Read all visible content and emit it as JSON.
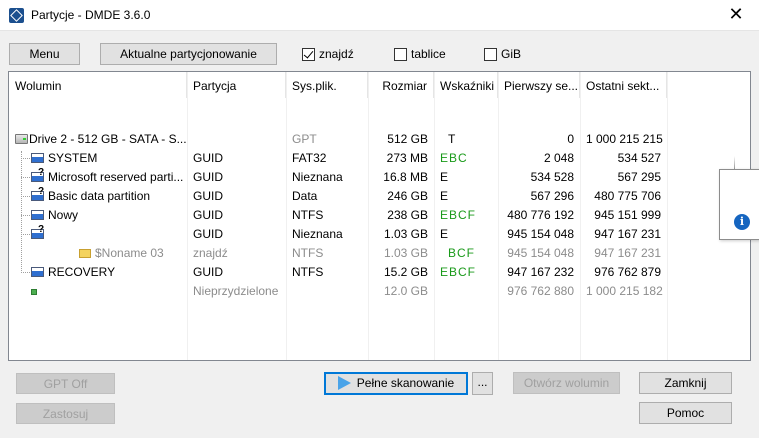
{
  "window": {
    "title": "Partycje - DMDE 3.6.0",
    "close": "✕"
  },
  "toolbar": {
    "menu": "Menu",
    "current_partitioning": "Aktualne partycjonowanie",
    "found_label": "znajdź",
    "found_checked": true,
    "tables_label": "tablice",
    "tables_checked": false,
    "gib_label": "GiB",
    "gib_checked": false
  },
  "columns": [
    "Wolumin",
    "Partycja",
    "Sys.plik.",
    "Rozmiar",
    "Wskaźniki",
    "Pierwszy se...",
    "Ostatni sekt..."
  ],
  "rows": [
    {
      "name": "Drive 2 - 512 GB - SATA - S...",
      "partition": "",
      "fs": "GPT",
      "size": "512 GB",
      "flags": "T",
      "first": "0",
      "last": "1 000 215 215",
      "icon": "drive-icon",
      "style": "drive"
    },
    {
      "name": "SYSTEM",
      "partition": "GUID",
      "fs": "FAT32",
      "size": "273 MB",
      "flags": "EBC",
      "first": "2 048",
      "last": "534 527",
      "icon": "partition-icon",
      "style": "normal"
    },
    {
      "name": "Microsoft reserved parti...",
      "partition": "GUID",
      "fs": "Nieznana",
      "size": "16.8 MB",
      "flags": "E",
      "first": "534 528",
      "last": "567 295",
      "icon": "partition-unknown-icon",
      "style": "normal"
    },
    {
      "name": "Basic data partition",
      "partition": "GUID",
      "fs": "Data",
      "size": "246 GB",
      "flags": "E",
      "first": "567 296",
      "last": "480 775 706",
      "icon": "partition-unknown-icon",
      "style": "normal"
    },
    {
      "name": "Nowy",
      "partition": "GUID",
      "fs": "NTFS",
      "size": "238 GB",
      "flags": "EBCF",
      "first": "480 776 192",
      "last": "945 151 999",
      "icon": "partition-icon",
      "style": "normal"
    },
    {
      "name": "",
      "partition": "GUID",
      "fs": "Nieznana",
      "size": "1.03 GB",
      "flags": "E",
      "first": "945 154 048",
      "last": "947 167 231",
      "icon": "partition-unknown-icon",
      "style": "normal"
    },
    {
      "name": "$Noname 03",
      "partition": "znajdź",
      "fs": "NTFS",
      "size": "1.03 GB",
      "flags": "BCF",
      "first": "945 154 048",
      "last": "947 167 231",
      "icon": "folder-icon",
      "style": "found"
    },
    {
      "name": "RECOVERY",
      "partition": "GUID",
      "fs": "NTFS",
      "size": "15.2 GB",
      "flags": "EBCF",
      "first": "947 167 232",
      "last": "976 762 879",
      "icon": "partition-icon",
      "style": "normal"
    },
    {
      "name": "",
      "partition": "Nieprzydzielone",
      "fs": "",
      "size": "12.0 GB",
      "flags": "",
      "first": "976 762 880",
      "last": "1 000 215 182",
      "icon": "unallocated-icon",
      "style": "unalloc"
    }
  ],
  "tooltip": {
    "icon": "info-icon",
    "text": ""
  },
  "buttons": {
    "gpt_off": "GPT Off",
    "apply": "Zastosuj",
    "full_scan": "Pełne skanowanie",
    "more": "...",
    "open_volume": "Otwórz wolumin",
    "close": "Zamknij",
    "help": "Pomoc"
  }
}
